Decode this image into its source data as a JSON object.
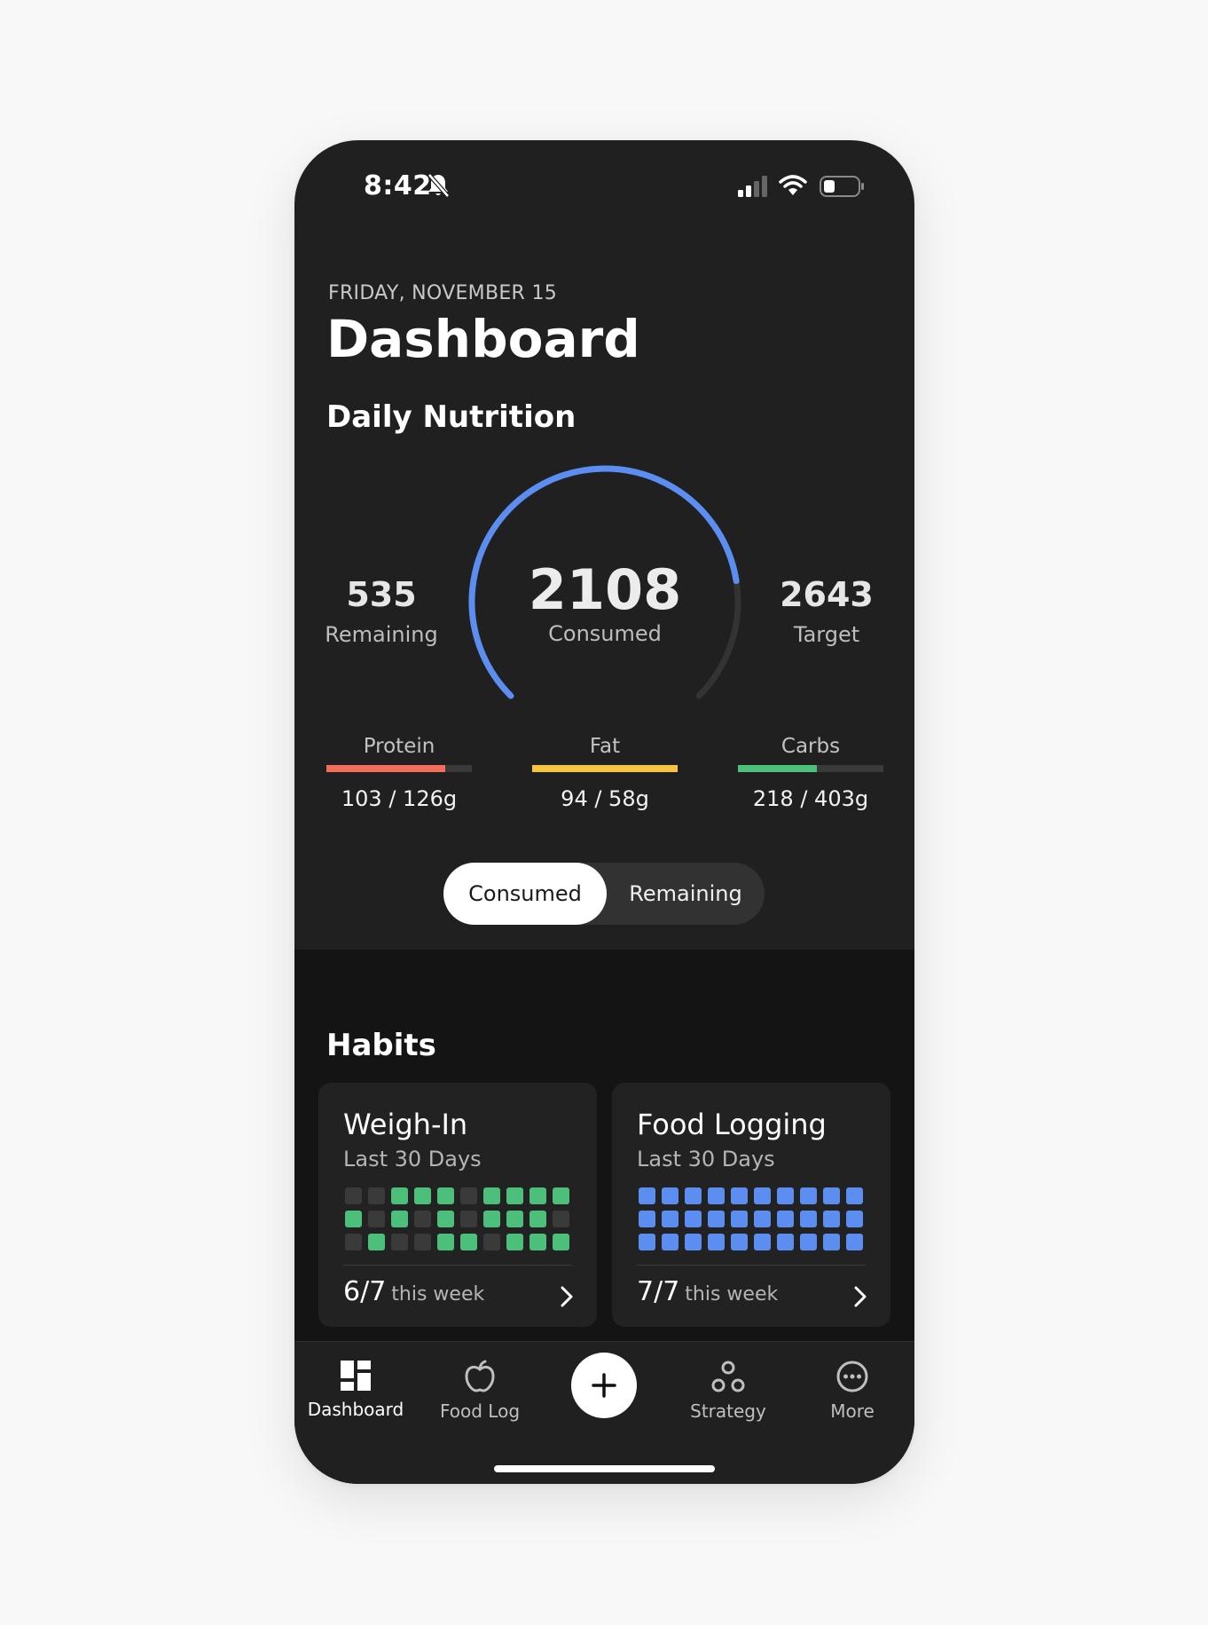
{
  "status": {
    "time": "8:42"
  },
  "header": {
    "date": "FRIDAY, NOVEMBER 15",
    "title": "Dashboard"
  },
  "nutrition": {
    "section_title": "Daily Nutrition",
    "remaining_value": "535",
    "remaining_label": "Remaining",
    "consumed_value": "2108",
    "consumed_label": "Consumed",
    "target_value": "2643",
    "target_label": "Target",
    "gauge_fraction": 0.8,
    "gauge_color": "#5b8ef0",
    "gauge_track": "#333333",
    "macros": [
      {
        "name": "Protein",
        "value": "103 / 126g",
        "fraction": 0.82,
        "color": "#f26d5b"
      },
      {
        "name": "Fat",
        "value": "94 / 58g",
        "fraction": 1.0,
        "color": "#f5c542"
      },
      {
        "name": "Carbs",
        "value": "218 / 403g",
        "fraction": 0.54,
        "color": "#4cbf7a"
      }
    ],
    "toggle": {
      "selected": "Consumed",
      "other": "Remaining"
    }
  },
  "habits": {
    "title": "Habits",
    "cards": [
      {
        "title": "Weigh-In",
        "subtitle": "Last 30 Days",
        "count": "6/7",
        "suffix": "this week",
        "color": "#4cbf7a",
        "days": [
          0,
          0,
          1,
          1,
          1,
          0,
          1,
          1,
          1,
          1,
          1,
          0,
          1,
          0,
          1,
          0,
          1,
          1,
          1,
          0,
          0,
          1,
          0,
          0,
          1,
          1,
          0,
          1,
          1,
          1
        ]
      },
      {
        "title": "Food Logging",
        "subtitle": "Last 30 Days",
        "count": "7/7",
        "suffix": "this week",
        "color": "#5b8ef0",
        "days": [
          1,
          1,
          1,
          1,
          1,
          1,
          1,
          1,
          1,
          1,
          1,
          1,
          1,
          1,
          1,
          1,
          1,
          1,
          1,
          1,
          1,
          1,
          1,
          1,
          1,
          1,
          1,
          1,
          1,
          1
        ]
      }
    ]
  },
  "nav": {
    "items": [
      {
        "label": "Dashboard",
        "icon": "dashboard-icon",
        "active": true
      },
      {
        "label": "Food Log",
        "icon": "apple-icon",
        "active": false
      },
      {
        "label": "Strategy",
        "icon": "strategy-icon",
        "active": false
      },
      {
        "label": "More",
        "icon": "more-icon",
        "active": false
      }
    ]
  }
}
